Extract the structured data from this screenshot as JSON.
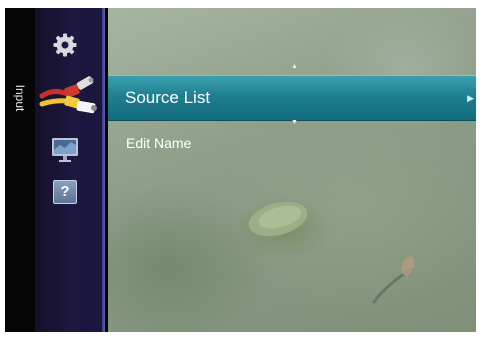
{
  "sidebar": {
    "section_label": "Input",
    "items": [
      {
        "icon": "gear-icon",
        "selected": false
      },
      {
        "icon": "input-cable-icon",
        "selected": true
      },
      {
        "icon": "monitor-icon",
        "selected": false
      },
      {
        "icon": "help-icon",
        "selected": false
      }
    ],
    "help_glyph": "?"
  },
  "menu": {
    "items": [
      {
        "label": "Source List",
        "selected": true
      },
      {
        "label": "Edit Name",
        "selected": false
      }
    ],
    "scroll_up_glyph": "▲",
    "scroll_down_glyph": "▼",
    "submenu_glyph": "▶"
  },
  "colors": {
    "highlight": "#1f7f90",
    "icon_column": "#1d1840"
  }
}
